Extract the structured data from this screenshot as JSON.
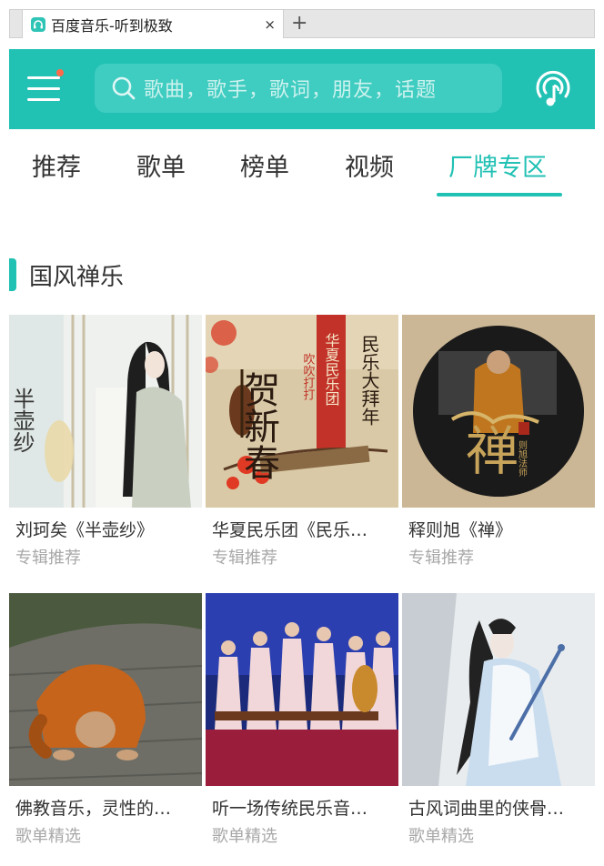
{
  "browser": {
    "tab_title": "百度音乐-听到极致",
    "close_glyph": "×",
    "new_tab_glyph": "+"
  },
  "header": {
    "search_placeholder": "歌曲，歌手，歌词，朋友，话题",
    "menu_icon": "hamburger-menu-icon",
    "listen_icon": "music-recognition-icon",
    "accent_color": "#21c1b4",
    "notification_dot_color": "#ff6b4a"
  },
  "nav": {
    "tabs": [
      {
        "label": "推荐",
        "active": false
      },
      {
        "label": "歌单",
        "active": false
      },
      {
        "label": "榜单",
        "active": false
      },
      {
        "label": "视频",
        "active": false
      },
      {
        "label": "厂牌专区",
        "active": true
      }
    ]
  },
  "section": {
    "title": "国风禅乐"
  },
  "cards": [
    {
      "name": "刘珂矣《半壶纱》",
      "sub": "专辑推荐",
      "cover_text": "半壶纱"
    },
    {
      "name": "华夏民乐团《民乐…",
      "sub": "专辑推荐",
      "cover_text": "贺新春",
      "cover_text2": "民乐大拜年",
      "cover_text3": "华夏民乐团",
      "cover_text4": "吹吹打打"
    },
    {
      "name": "释则旭《禅》",
      "sub": "专辑推荐",
      "cover_text": "禅",
      "cover_text2": "则旭法师"
    },
    {
      "name": "佛教音乐，灵性的…",
      "sub": "歌单精选"
    },
    {
      "name": "听一场传统民乐音…",
      "sub": "歌单精选"
    },
    {
      "name": "古风词曲里的侠骨…",
      "sub": "歌单精选"
    }
  ]
}
